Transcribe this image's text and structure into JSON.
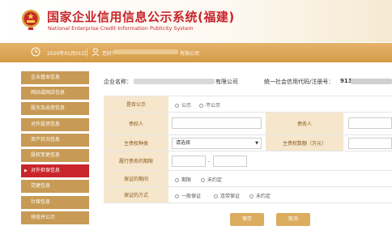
{
  "header": {
    "title_cn": "国家企业信用信息公示系统(福建)",
    "title_en": "National Enterprise Credit Information Publicity System"
  },
  "infobar": {
    "date": "2020年01月01日",
    "greeting": "您好！",
    "company_suffix": "有限公司"
  },
  "sidebar": {
    "items": [
      {
        "label": "企业基本信息",
        "active": false
      },
      {
        "label": "网站或网店信息",
        "active": false
      },
      {
        "label": "股东及出资信息",
        "active": false
      },
      {
        "label": "对外投资信息",
        "active": false
      },
      {
        "label": "资产状况信息",
        "active": false
      },
      {
        "label": "股权变更信息",
        "active": false
      },
      {
        "label": "对外担保信息",
        "active": true
      },
      {
        "label": "党建信息",
        "active": false
      },
      {
        "label": "社保信息",
        "active": false
      },
      {
        "label": "预览并公示",
        "active": false
      }
    ]
  },
  "company": {
    "name_label": "企业名称：",
    "name_suffix": "有限公司",
    "code_label": "统一社会信用代码/注册号：",
    "code_prefix": "9135"
  },
  "form": {
    "public_label": "是否公示",
    "public_options": [
      "公示",
      "不公示"
    ],
    "creditor_label": "债权人",
    "debtor_label": "债务人",
    "claim_type_label": "主债权种类",
    "claim_type_value": "请选择",
    "claim_amount_label": "主债权数额（万元）",
    "period_label": "履行债务的期限",
    "period_sep": "-",
    "guarantee_period_label": "保证的期间",
    "guarantee_period_options": [
      "期限",
      "未约定"
    ],
    "guarantee_method_label": "保证的方式",
    "guarantee_method_options": [
      "一般保证",
      "连带保证",
      "未约定"
    ]
  },
  "buttons": {
    "save": "保存",
    "cancel": "取消"
  },
  "colors": {
    "brand_red": "#c9262b",
    "gold": "#d49a47",
    "sidebar_gold": "#c79a55",
    "label_bg": "#f5e6cc"
  }
}
